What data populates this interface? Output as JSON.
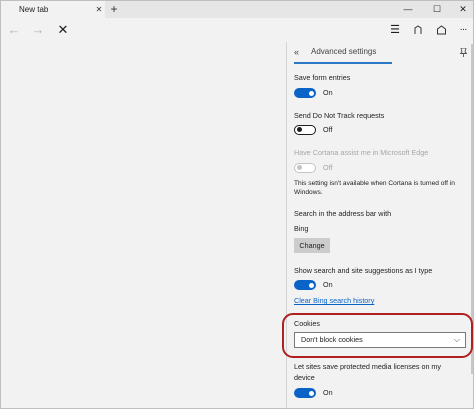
{
  "tab": {
    "title": "New tab",
    "close_glyph": "✕"
  },
  "tabstrip": {
    "new_tab_glyph": "+"
  },
  "window": {
    "minimize": "—",
    "maximize": "☐",
    "close": "✕"
  },
  "navbar": {
    "back_glyph": "←",
    "forward_glyph": "→",
    "stop_glyph": "✕",
    "hub_glyph": "☰",
    "share_glyph": "⟂",
    "more_glyph": "···",
    "icons": [
      "back-icon",
      "forward-icon",
      "stop-icon",
      "hub-icon",
      "web-note-icon",
      "more-icon"
    ]
  },
  "pane": {
    "back_glyph": "«",
    "title": "Advanced settings",
    "save_form": {
      "label": "Save form entries",
      "state": "On"
    },
    "dnt": {
      "label": "Send Do Not Track requests",
      "state": "Off"
    },
    "cortana": {
      "label": "Have Cortana assist me in Microsoft Edge",
      "state": "Off",
      "note": "This setting isn't available when Cortana is turned off in Windows."
    },
    "search": {
      "label": "Search in the address bar with",
      "engine": "Bing",
      "button": "Change"
    },
    "suggestions": {
      "label": "Show search and site suggestions as I type",
      "state": "On",
      "clear_link": "Clear Bing search history"
    },
    "cookies": {
      "label": "Cookies",
      "selected": "Don't block cookies",
      "chevron": "⌵"
    },
    "licenses": {
      "label_line1": "Let sites save protected media licenses on my",
      "label_line2": "device",
      "state": "On"
    }
  },
  "colors": {
    "accent": "#0a64c8",
    "highlight_ring": "#b02020"
  }
}
